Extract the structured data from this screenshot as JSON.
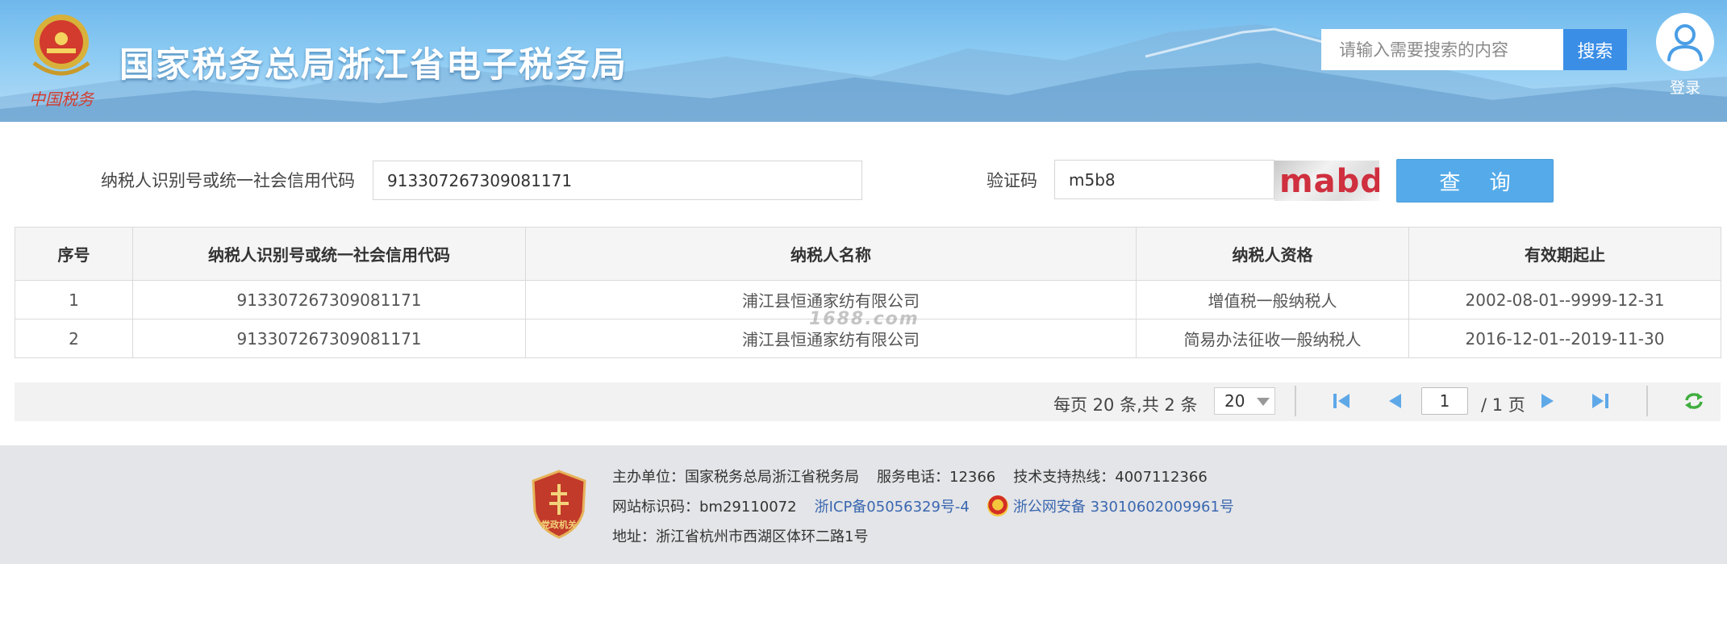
{
  "header": {
    "site_title": "国家税务总局浙江省电子税务局",
    "search_placeholder": "请输入需要搜索的内容",
    "search_button": "搜索",
    "login_label": "登录",
    "emblem_caption": "中国税务"
  },
  "query_form": {
    "taxid_label": "纳税人识别号或统一社会信用代码",
    "taxid_value": "913307267309081171",
    "captcha_label": "验证码",
    "captcha_value": "m5b8",
    "captcha_image_text": "mabd",
    "query_button": "查 询"
  },
  "table": {
    "headers": [
      "序号",
      "纳税人识别号或统一社会信用代码",
      "纳税人名称",
      "纳税人资格",
      "有效期起止"
    ],
    "rows": [
      [
        "1",
        "913307267309081171",
        "浦江县恒通家纺有限公司",
        "增值税一般纳税人",
        "2002-08-01--9999-12-31"
      ],
      [
        "2",
        "913307267309081171",
        "浦江县恒通家纺有限公司",
        "简易办法征收一般纳税人",
        "2016-12-01--2019-11-30"
      ]
    ]
  },
  "watermark": "1688.com",
  "pager": {
    "summary": "每页 20 条,共 2 条",
    "page_size": "20",
    "current_page": "1",
    "total_pages_label": "/ 1 页"
  },
  "footer": {
    "host_line": "主办单位：国家税务总局浙江省税务局",
    "service_phone": "服务电话：12366",
    "support_hotline": "技术支持热线：4007112366",
    "site_code": "网站标识码：bm29110072",
    "icp": "浙ICP备05056329号-4",
    "police_record": "浙公网安备 33010602009961号",
    "address": "地址：浙江省杭州市西湖区体环二路1号",
    "logo_text": "党政机关"
  },
  "colors": {
    "header_sky": "#8ccbf3",
    "search_button": "#3a8ee6",
    "query_button": "#55abe9",
    "captcha_text": "#cf2f3e",
    "footer_bg": "#e4e5e8",
    "link": "#3a67b0",
    "pager_icon": "#5ea8e8",
    "refresh_icon": "#3fae3f"
  },
  "icons": [
    "national-emblem-icon",
    "user-avatar-icon",
    "first-page-icon",
    "prev-page-icon",
    "next-page-icon",
    "last-page-icon",
    "refresh-icon",
    "party-government-logo-icon",
    "police-badge-icon"
  ]
}
